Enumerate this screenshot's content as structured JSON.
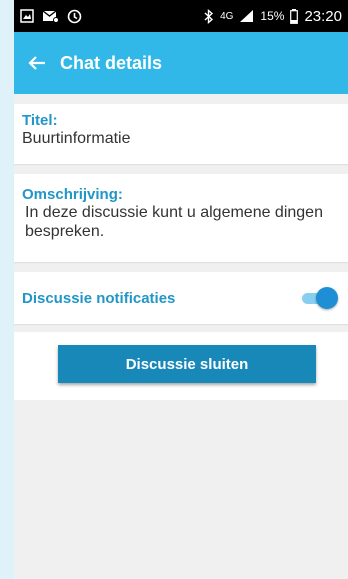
{
  "status_bar": {
    "network": "4G",
    "battery": "15%",
    "time": "23:20"
  },
  "app_bar": {
    "title": "Chat details"
  },
  "details": {
    "title_label": "Titel:",
    "title_value": "Buurtinformatie",
    "description_label": "Omschrijving:",
    "description_value": "In deze discussie kunt u algemene dingen bespreken.",
    "notifications_label": "Discussie notificaties",
    "notifications_enabled": true
  },
  "actions": {
    "close_label": "Discussie sluiten"
  },
  "colors": {
    "app_bar": "#31b7e8",
    "label": "#2196c7",
    "button": "#1788b8",
    "toggle_thumb": "#1e8fd5"
  }
}
